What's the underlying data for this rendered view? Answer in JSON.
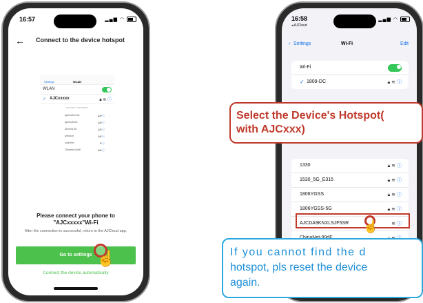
{
  "left_phone": {
    "status_time": "16:57",
    "title": "Connect to the device hotspot",
    "back_icon": "arrow-left-icon",
    "mini_settings": {
      "back_label": "Settings",
      "title": "WLAN",
      "wlan_label": "WLAN",
      "connected": "AJCxxxxx",
      "section": "CHOOSE A NETWORK...",
      "networks": [
        "Apinsoft-0 AD",
        "Apinsoft-5G",
        "Almsoft-5G",
        "alfrocion",
        "coal free",
        "Chinanet-Aq00"
      ]
    },
    "instruction_line1": "Please connect your phone to",
    "instruction_line2": "\"AJCxxxxx\"Wi-Fi",
    "after_text": "After the connection is successful, return to the AJCloud app.",
    "go_button": "Go to settings",
    "auto_link": "Connect the device automatically"
  },
  "right_phone": {
    "status_time": "16:58",
    "status_sub": "◂ AJCloud",
    "nav_back": "Settings",
    "nav_title": "Wi-Fi",
    "nav_edit": "Edit",
    "wifi_label": "Wi-Fi",
    "connected_network": "1809-DC",
    "networks": [
      "1330",
      "1530_5G_E315",
      "1806YGSS",
      "1806YGSS-5G",
      "AJCDA9KNXLSJF5SR",
      "ChinaNet-99dF"
    ],
    "highlighted_network": "AJCDA9KNXLSJF5SR"
  },
  "callouts": {
    "select_line1": "Select the Device's Hotspot(",
    "select_line2": "with AJCxxx)",
    "reset_line1": "If you cannot find the d",
    "reset_line2": "hotspot, pls reset the device",
    "reset_line3": "again."
  },
  "colors": {
    "accent_green": "#4cc24c",
    "ios_blue": "#1a73e8",
    "callout_red": "#c0392b",
    "callout_blue": "#2aa9e0"
  }
}
